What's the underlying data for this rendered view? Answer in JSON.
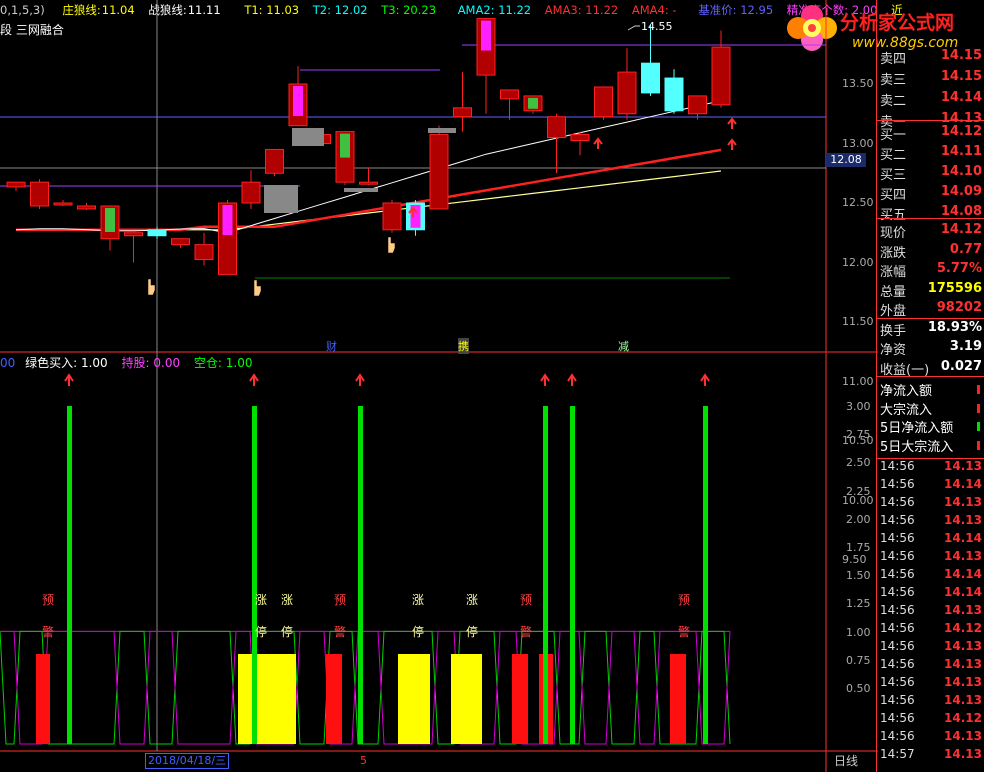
{
  "header": {
    "params": "0,1,5,3)",
    "zhuanglang_label": "庄狼线:",
    "zhuanglang_value": "11.04",
    "zhanlang_label": "战狼线:",
    "zhanlang_value": "11.11",
    "t1": "T1: 11.03",
    "t2": "T2: 12.02",
    "t3": "T3: 20.23",
    "ama2": "AMA2: 11.22",
    "ama3": "AMA3: 11.22",
    "ama4": "AMA4: -",
    "base_price": "基准价: 12.95",
    "points": "精准点个数: 2.00",
    "trailing": "近",
    "subtitle": "段 三网融合",
    "peak_label": "14.55"
  },
  "watermark": {
    "text": "分析家公式网",
    "url": "www.88gs.com"
  },
  "price_axis": [
    "13.50",
    "13.00",
    "12.50",
    "12.00",
    "11.50",
    "11.00",
    "10.50",
    "10.00",
    "9.50"
  ],
  "current_price_tag": "12.08",
  "event_markers": [
    "财",
    "携",
    "减"
  ],
  "indicator_header": {
    "left": "00",
    "green_buy": "绿色买入: 1.00",
    "hold": "持股: 0.00",
    "empty": "空仓: 1.00"
  },
  "indicator_axis": [
    "3.00",
    "2.75",
    "2.50",
    "2.25",
    "2.00",
    "1.75",
    "1.50",
    "1.25",
    "1.00",
    "0.75",
    "0.50"
  ],
  "indicator_texts": {
    "yujing": [
      "预",
      "警"
    ],
    "zhangting": [
      "涨",
      "停"
    ]
  },
  "bottom_bar": {
    "date": "2018/04/18/三",
    "marker": "5",
    "period": "日线"
  },
  "quote_panel": {
    "sell": [
      {
        "label": "卖四",
        "value": "14.15"
      },
      {
        "label": "卖三",
        "value": "14.15"
      },
      {
        "label": "卖二",
        "value": "14.14"
      },
      {
        "label": "卖一",
        "value": "14.13"
      }
    ],
    "buy": [
      {
        "label": "买一",
        "value": "14.12"
      },
      {
        "label": "买二",
        "value": "14.11"
      },
      {
        "label": "买三",
        "value": "14.10"
      },
      {
        "label": "买四",
        "value": "14.09"
      },
      {
        "label": "买五",
        "value": "14.08"
      }
    ],
    "stats": [
      {
        "label": "现价",
        "value": "14.12",
        "color": "#ff3030"
      },
      {
        "label": "涨跌",
        "value": "0.77",
        "color": "#ff3030"
      },
      {
        "label": "涨幅",
        "value": "5.77%",
        "color": "#ff3030"
      },
      {
        "label": "总量",
        "value": "175596",
        "color": "#ffff00"
      },
      {
        "label": "外盘",
        "value": "98202",
        "color": "#ff3030"
      },
      {
        "label": "换手",
        "value": "18.93%",
        "color": "#ffffff"
      },
      {
        "label": "净资",
        "value": "3.19",
        "color": "#ffffff"
      },
      {
        "label": "收益(一)",
        "value": "0.027",
        "color": "#ffffff"
      }
    ],
    "flows": [
      "净流入额",
      "大宗流入",
      "5日净流入额",
      "5日大宗流入"
    ],
    "ticks": [
      {
        "t": "14:56",
        "p": "14.13"
      },
      {
        "t": "14:56",
        "p": "14.14"
      },
      {
        "t": "14:56",
        "p": "14.13"
      },
      {
        "t": "14:56",
        "p": "14.13"
      },
      {
        "t": "14:56",
        "p": "14.14"
      },
      {
        "t": "14:56",
        "p": "14.13"
      },
      {
        "t": "14:56",
        "p": "14.14"
      },
      {
        "t": "14:56",
        "p": "14.14"
      },
      {
        "t": "14:56",
        "p": "14.13"
      },
      {
        "t": "14:56",
        "p": "14.12"
      },
      {
        "t": "14:56",
        "p": "14.13"
      },
      {
        "t": "14:56",
        "p": "14.13"
      },
      {
        "t": "14:56",
        "p": "14.13"
      },
      {
        "t": "14:56",
        "p": "14.13"
      },
      {
        "t": "14:56",
        "p": "14.12"
      },
      {
        "t": "14:56",
        "p": "14.13"
      },
      {
        "t": "14:57",
        "p": "14.13"
      }
    ]
  },
  "candles": [
    {
      "o": 11.77,
      "h": 11.85,
      "l": 11.7,
      "c": 11.85
    },
    {
      "o": 11.45,
      "h": 11.9,
      "l": 11.4,
      "c": 11.85
    },
    {
      "o": 11.5,
      "h": 11.55,
      "l": 11.45,
      "c": 11.5
    },
    {
      "o": 11.4,
      "h": 11.5,
      "l": 11.38,
      "c": 11.45
    },
    {
      "o": 10.9,
      "h": 11.45,
      "l": 10.7,
      "c": 11.45
    },
    {
      "o": 10.95,
      "h": 11.0,
      "l": 10.5,
      "c": 11.0
    },
    {
      "o": 11.05,
      "h": 11.1,
      "l": 10.9,
      "c": 10.95
    },
    {
      "o": 10.8,
      "h": 10.9,
      "l": 10.75,
      "c": 10.9
    },
    {
      "o": 10.55,
      "h": 11.0,
      "l": 10.45,
      "c": 10.8
    },
    {
      "o": 10.3,
      "h": 11.55,
      "l": 10.3,
      "c": 11.5
    },
    {
      "o": 11.5,
      "h": 12.05,
      "l": 11.4,
      "c": 11.85
    },
    {
      "o": 12.0,
      "h": 12.4,
      "l": 11.95,
      "c": 12.4
    },
    {
      "o": 12.8,
      "h": 13.8,
      "l": 12.8,
      "c": 13.5
    },
    {
      "o": 12.5,
      "h": 12.6,
      "l": 12.5,
      "c": 12.65
    },
    {
      "o": 11.85,
      "h": 12.7,
      "l": 11.8,
      "c": 12.7
    },
    {
      "o": 11.85,
      "h": 12.1,
      "l": 11.8,
      "c": 11.85
    },
    {
      "o": 11.05,
      "h": 11.55,
      "l": 11.0,
      "c": 11.5
    },
    {
      "o": 11.5,
      "h": 11.55,
      "l": 10.95,
      "c": 11.05
    },
    {
      "o": 11.4,
      "h": 12.8,
      "l": 11.4,
      "c": 12.65
    },
    {
      "o": 12.95,
      "h": 13.7,
      "l": 12.7,
      "c": 13.1
    },
    {
      "o": 13.65,
      "h": 14.55,
      "l": 13.0,
      "c": 14.6
    },
    {
      "o": 13.25,
      "h": 13.3,
      "l": 12.9,
      "c": 13.4
    },
    {
      "o": 13.05,
      "h": 13.2,
      "l": 13.0,
      "c": 13.3
    },
    {
      "o": 12.6,
      "h": 13.0,
      "l": 12.0,
      "c": 12.95
    },
    {
      "o": 12.55,
      "h": 12.7,
      "l": 12.3,
      "c": 12.65
    },
    {
      "o": 12.95,
      "h": 13.3,
      "l": 12.9,
      "c": 13.45
    },
    {
      "o": 13.0,
      "h": 14.1,
      "l": 12.9,
      "c": 13.7
    },
    {
      "o": 13.85,
      "h": 14.5,
      "l": 13.3,
      "c": 13.35
    },
    {
      "o": 13.6,
      "h": 13.75,
      "l": 13.0,
      "c": 13.05
    },
    {
      "o": 13.0,
      "h": 13.3,
      "l": 12.9,
      "c": 13.3
    },
    {
      "o": 13.15,
      "h": 14.4,
      "l": 13.1,
      "c": 14.12
    }
  ]
}
